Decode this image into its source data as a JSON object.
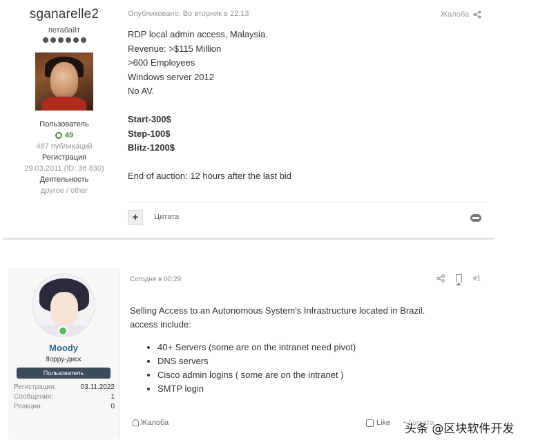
{
  "post1": {
    "author": {
      "username": "sganarelle2",
      "title": "петабайт",
      "role": "Пользователь",
      "reputation": "49",
      "posts": "487 публикаций",
      "reg_label": "Регистрация",
      "reg_value": "29.03.2011 (ID: 36 830)",
      "activity_label": "Деятельность",
      "activity_value": "другое / other"
    },
    "header": {
      "published": "Опубликовано: Во вторник в 22:13",
      "report": "Жалоба"
    },
    "body": {
      "line1": "RDP local admin access, Malaysia.",
      "line2": "Revenue: >$115 Million",
      "line3": ">600 Employees",
      "line4": "Windows server 2012",
      "line5": "No AV.",
      "start": "Start-300$",
      "step": "Step-100$",
      "blitz": "Blitz-1200$",
      "end": "End of auction: 12 hours after the last bid"
    },
    "footer": {
      "plus": "+",
      "quote": "Цитата"
    }
  },
  "post2": {
    "author": {
      "username": "Moody",
      "title": "floppy-диск",
      "badge": "Пользователь",
      "stats": [
        {
          "label": "Регистрация:",
          "value": "03.11.2022"
        },
        {
          "label": "Сообщения:",
          "value": "1"
        },
        {
          "label": "Реакции:",
          "value": "0"
        }
      ]
    },
    "header": {
      "date": "Сегодня в 00:29",
      "number": "#1"
    },
    "body": {
      "line1": "Selling Access to an Autonomous System's Infrastructure located in Brazil.",
      "line2": "access include:",
      "items": [
        "40+ Servers (some are on the intranet need pivot)",
        "DNS servers",
        "Cisco admin logins ( some are on the intranet )",
        "SMTP login"
      ]
    },
    "footer": {
      "report": "Жалоба",
      "like": "Like",
      "quote": "+ Цитата"
    }
  },
  "watermark": "头条 @区块软件开发"
}
